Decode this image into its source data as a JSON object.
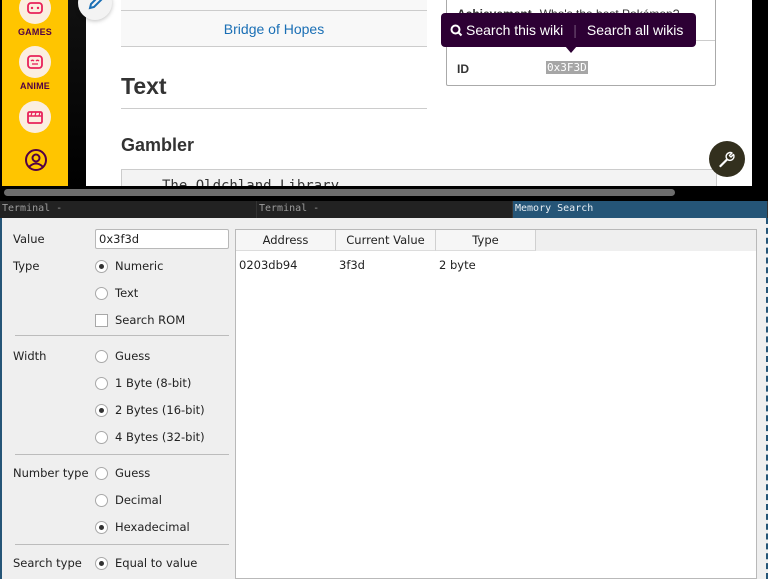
{
  "browser": {
    "sidebar": {
      "items": [
        {
          "label": "GAMES",
          "icon": "gamepad-icon"
        },
        {
          "label": "ANIME",
          "icon": "anime-face-icon"
        },
        {
          "label": "",
          "icon": "clapperboard-icon"
        },
        {
          "label": "",
          "icon": "user-account-icon"
        }
      ],
      "accent": "#ffc500"
    },
    "article": {
      "link_row": "Bridge of Hopes",
      "section_heading": "Text",
      "subsection_heading": "Gambler",
      "code_text": "The Oldchland Library"
    },
    "infobox": {
      "rows": [
        {
          "label": "Achievement",
          "value": "Who's the best Pokémon?"
        },
        {
          "label": "ID",
          "value": "0x3F3D"
        }
      ]
    },
    "search_tooltip": {
      "this_wiki": "Search this wiki",
      "all_wikis": "Search all wikis",
      "separator": "|"
    }
  },
  "tabs": [
    {
      "label": "Terminal -",
      "active": false
    },
    {
      "label": "Terminal -",
      "active": false
    },
    {
      "label": "Memory Search",
      "active": true
    }
  ],
  "memory_search": {
    "value_label": "Value",
    "value": "0x3f3d",
    "type": {
      "label": "Type",
      "options": [
        {
          "label": "Numeric",
          "checked": true
        },
        {
          "label": "Text",
          "checked": false
        }
      ],
      "search_rom": {
        "label": "Search ROM",
        "checked": false
      }
    },
    "width": {
      "label": "Width",
      "options": [
        {
          "label": "Guess",
          "checked": false
        },
        {
          "label": "1 Byte (8-bit)",
          "checked": false
        },
        {
          "label": "2 Bytes (16-bit)",
          "checked": true
        },
        {
          "label": "4 Bytes (32-bit)",
          "checked": false
        }
      ]
    },
    "number_type": {
      "label": "Number type",
      "options": [
        {
          "label": "Guess",
          "checked": false
        },
        {
          "label": "Decimal",
          "checked": false
        },
        {
          "label": "Hexadecimal",
          "checked": true
        }
      ]
    },
    "search_type": {
      "label": "Search type",
      "options": [
        {
          "label": "Equal to value",
          "checked": true
        }
      ]
    },
    "results": {
      "columns": [
        "Address",
        "Current Value",
        "Type"
      ],
      "rows": [
        [
          "0203db94",
          "3f3d",
          "2 byte"
        ]
      ]
    }
  }
}
